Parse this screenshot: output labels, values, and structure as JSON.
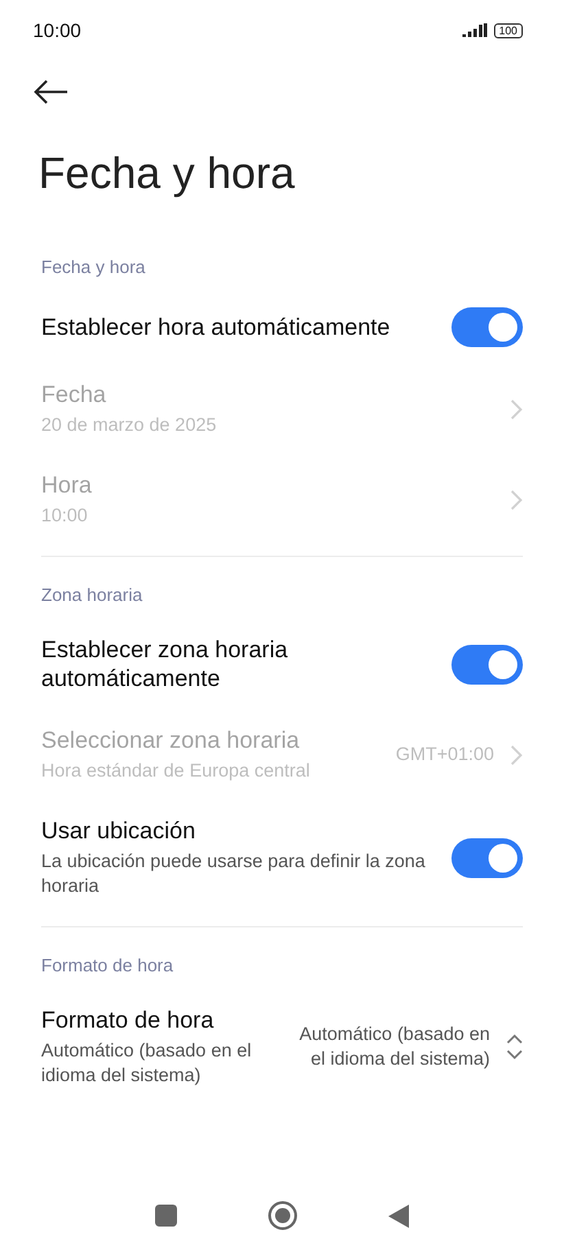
{
  "status_bar": {
    "time": "10:00",
    "battery": "100"
  },
  "title": "Fecha y hora",
  "sections": [
    {
      "header": "Fecha y hora",
      "items": [
        {
          "kind": "toggle",
          "title": "Establecer hora automáticamente",
          "on": true,
          "disabled": false
        },
        {
          "kind": "link",
          "title": "Fecha",
          "subtitle": "20 de marzo de 2025",
          "disabled": true
        },
        {
          "kind": "link",
          "title": "Hora",
          "subtitle": "10:00",
          "disabled": true
        }
      ]
    },
    {
      "header": "Zona horaria",
      "items": [
        {
          "kind": "toggle",
          "title": "Establecer zona horaria automáticamente",
          "on": true,
          "disabled": false
        },
        {
          "kind": "link",
          "title": "Seleccionar zona horaria",
          "subtitle": "Hora estándar de Europa central",
          "value": "GMT+01:00",
          "disabled": true
        },
        {
          "kind": "toggle",
          "title": "Usar ubicación",
          "subtitle": "La ubicación puede usarse para definir la zona horaria",
          "on": true,
          "disabled": false
        }
      ]
    },
    {
      "header": "Formato de hora",
      "items": [
        {
          "kind": "select",
          "title": "Formato de hora",
          "subtitle": "Automático (basado en el idioma del sistema)",
          "value": "Automático (basado en el idioma del sistema)",
          "disabled": false
        }
      ]
    }
  ]
}
